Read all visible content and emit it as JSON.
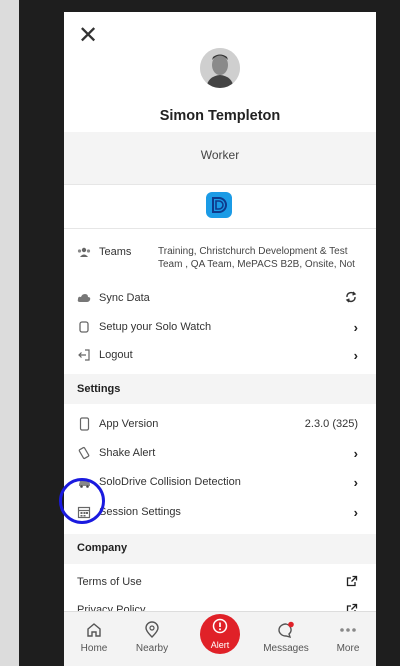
{
  "profile": {
    "name": "Simon Templeton",
    "role": "Worker"
  },
  "menu": {
    "teams_label": "Teams",
    "teams_value": "Training, Christchurch Development & Test Team , QA Team, MePACS B2B, Onsite, Not",
    "sync_label": "Sync Data",
    "watch_label": "Setup your Solo Watch",
    "logout_label": "Logout"
  },
  "settings": {
    "heading": "Settings",
    "app_version_label": "App Version",
    "app_version_value": "2.3.0 (325)",
    "shake_alert_label": "Shake Alert",
    "solodrive_label": "SoloDrive Collision Detection",
    "session_label": "Session Settings"
  },
  "company": {
    "heading": "Company",
    "terms_label": "Terms of Use",
    "privacy_label": "Privacy Policy"
  },
  "tabbar": {
    "home": "Home",
    "nearby": "Nearby",
    "alert": "Alert",
    "messages": "Messages",
    "more": "More"
  },
  "colors": {
    "alert_red": "#e02128",
    "app_logo_blue": "#1b9be6",
    "highlight_ring": "#1a1adf"
  }
}
